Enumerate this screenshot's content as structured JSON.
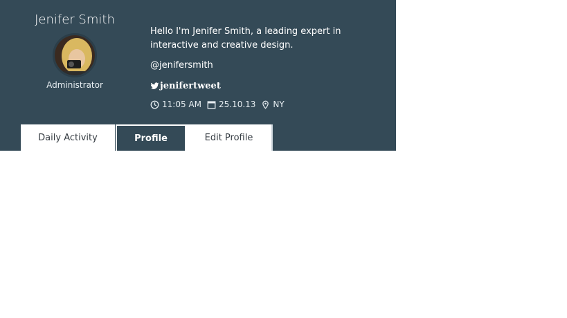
{
  "profile": {
    "name": "Jenifer Smith",
    "role": "Administrator",
    "bio": "Hello I'm Jenifer Smith, a leading expert in interactive and creative design.",
    "handle": "@jenifersmith",
    "twitter": "jenifertweet",
    "time": "11:05 AM",
    "date": "25.10.13",
    "location": "NY"
  },
  "tabs": [
    {
      "label": "Daily Activity",
      "active": false
    },
    {
      "label": "Profile",
      "active": true
    },
    {
      "label": "Edit Profile",
      "active": false
    }
  ],
  "icons": [
    "clock-icon",
    "calendar-icon",
    "location-pin-icon",
    "twitter-icon"
  ],
  "colors": {
    "card_bg": "#344a57",
    "text": "#ffffff",
    "tab_inactive_bg": "#ffffff"
  }
}
